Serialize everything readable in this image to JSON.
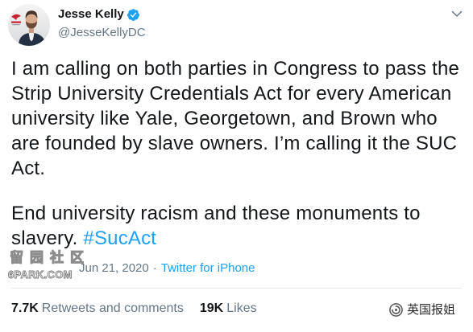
{
  "author": {
    "name": "Jesse Kelly",
    "handle": "@JesseKellyDC",
    "verified": true,
    "avatar_icon": "profile-photo"
  },
  "tweet": {
    "paragraph_1": [
      "I am calling on both parties in Congress to pass the",
      "Strip University Credentials Act for every American",
      "university like Yale, Georgetown, and Brown who",
      "are founded by slave owners. I’m calling it the SUC",
      "Act."
    ],
    "paragraph_2": [
      "End university racism and these monuments to",
      "slavery."
    ],
    "hashtag": "#SucAct"
  },
  "meta": {
    "date": "Jun 21, 2020",
    "separator": "·",
    "source": "Twitter for iPhone"
  },
  "stats": {
    "retweets": {
      "count": "7.7K",
      "label": "Retweets and comments"
    },
    "likes": {
      "count": "19K",
      "label": "Likes"
    }
  },
  "watermarks": {
    "forum_name": "留园社区",
    "forum_site": "6PARK.COM",
    "wechat_account": "英国报姐"
  },
  "icons": {
    "verified": "verified-badge-icon",
    "menu": "chevron-down-icon",
    "wechat": "wechat-official-account-icon"
  },
  "theme": {
    "text": "#14171a",
    "secondary": "#657786",
    "link": "#1da1f2",
    "divider": "#e6ecf0",
    "verified": "#1da1f2"
  }
}
